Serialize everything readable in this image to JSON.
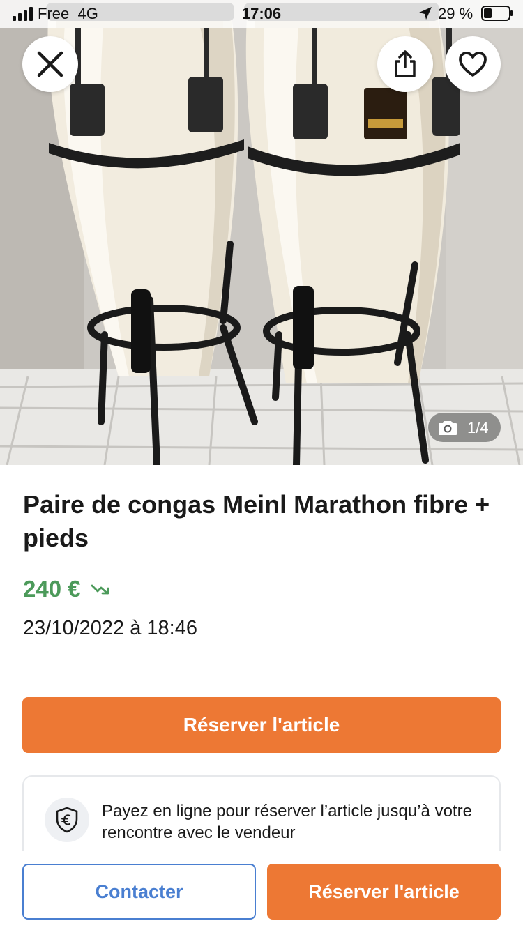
{
  "status_bar": {
    "carrier": "Free",
    "network": "4G",
    "time": "17:06",
    "battery": "29 %"
  },
  "photo": {
    "counter": "1/4"
  },
  "icons": {
    "close": "close-icon",
    "share": "share-icon",
    "favorite": "heart-icon",
    "camera": "camera-icon",
    "trend": "trending-down-icon",
    "shield": "euro-shield-icon"
  },
  "listing": {
    "title": "Paire de congas Meinl Marathon fibre + pieds",
    "price": "240 €",
    "date": "23/10/2022 à 18:46"
  },
  "actions": {
    "reserve_label": "Réserver l'article",
    "contact_label": "Contacter",
    "reserve_bottom_label": "Réserver l'article"
  },
  "payment_info": {
    "text": "Payez en ligne pour réserver l’article jusqu’à votre rencontre avec le vendeur"
  },
  "colors": {
    "accent_orange": "#ed7834",
    "price_green": "#4c9a5a",
    "contact_blue": "#4a7fd1"
  }
}
